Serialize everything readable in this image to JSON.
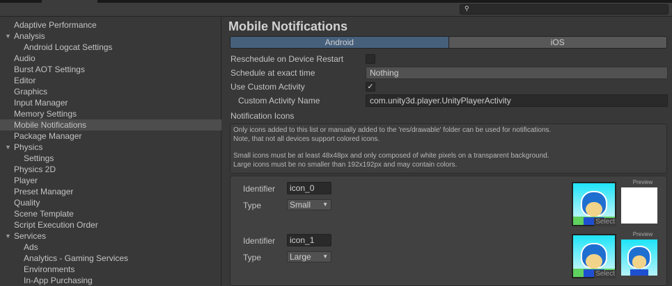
{
  "search": {
    "icon": "search-icon",
    "value": ""
  },
  "sidebar": {
    "items": [
      {
        "label": "Adaptive Performance",
        "level": 0
      },
      {
        "label": "Analysis",
        "level": 0,
        "expanded": true
      },
      {
        "label": "Android Logcat Settings",
        "level": 1
      },
      {
        "label": "Audio",
        "level": 0
      },
      {
        "label": "Burst AOT Settings",
        "level": 0
      },
      {
        "label": "Editor",
        "level": 0
      },
      {
        "label": "Graphics",
        "level": 0
      },
      {
        "label": "Input Manager",
        "level": 0
      },
      {
        "label": "Memory Settings",
        "level": 0
      },
      {
        "label": "Mobile Notifications",
        "level": 0,
        "selected": true
      },
      {
        "label": "Package Manager",
        "level": 0
      },
      {
        "label": "Physics",
        "level": 0,
        "expanded": true
      },
      {
        "label": "Settings",
        "level": 1
      },
      {
        "label": "Physics 2D",
        "level": 0
      },
      {
        "label": "Player",
        "level": 0
      },
      {
        "label": "Preset Manager",
        "level": 0
      },
      {
        "label": "Quality",
        "level": 0
      },
      {
        "label": "Scene Template",
        "level": 0
      },
      {
        "label": "Script Execution Order",
        "level": 0
      },
      {
        "label": "Services",
        "level": 0,
        "expanded": true
      },
      {
        "label": "Ads",
        "level": 1
      },
      {
        "label": "Analytics - Gaming Services",
        "level": 1
      },
      {
        "label": "Environments",
        "level": 1
      },
      {
        "label": "In-App Purchasing",
        "level": 1
      }
    ]
  },
  "main": {
    "title": "Mobile Notifications",
    "tabs": [
      {
        "label": "Android",
        "active": true
      },
      {
        "label": "iOS",
        "active": false
      }
    ],
    "reschedule_label": "Reschedule on Device Restart",
    "reschedule_checked": false,
    "schedule_label": "Schedule at exact time",
    "schedule_value": "Nothing",
    "custom_activity_label": "Use Custom Activity",
    "custom_activity_checked": true,
    "check_glyph": "✓",
    "activity_name_label": "Custom Activity Name",
    "activity_name_value": "com.unity3d.player.UnityPlayerActivity",
    "icons_label": "Notification Icons",
    "help": [
      "Only icons added to this list or manually added to the 'res/drawable' folder can be used for notifications.",
      "Note, that not all devices support colored icons.",
      "Small icons must be at least 48x48px and only composed of white pixels on a transparent background.",
      "Large icons must be no smaller than 192x192px and may contain colors."
    ],
    "icons": [
      {
        "identifier_label": "Identifier",
        "identifier": "icon_0",
        "type_label": "Type",
        "type": "Small",
        "select": "Select",
        "preview": "Preview"
      },
      {
        "identifier_label": "Identifier",
        "identifier": "icon_1",
        "type_label": "Type",
        "type": "Large",
        "select": "Select",
        "preview": "Preview"
      }
    ]
  },
  "colors": {
    "accent": "#46607c",
    "bg": "#383838",
    "selected": "#4d4d4d"
  }
}
